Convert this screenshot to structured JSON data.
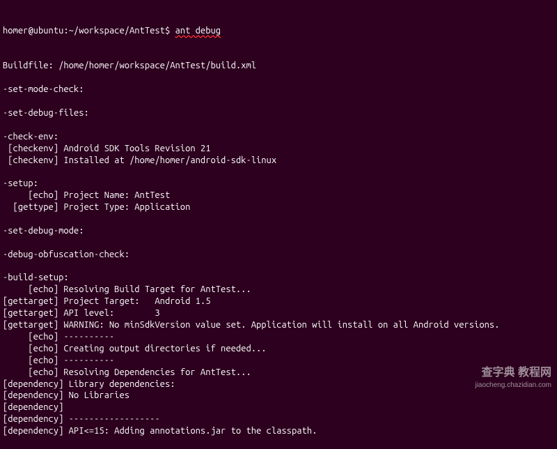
{
  "prompt": "homer@ubuntu:~/workspace/AntTest$ ",
  "command": "ant debug",
  "output": [
    "Buildfile: /home/homer/workspace/AntTest/build.xml",
    "",
    "-set-mode-check:",
    "",
    "-set-debug-files:",
    "",
    "-check-env:",
    " [checkenv] Android SDK Tools Revision 21",
    " [checkenv] Installed at /home/homer/android-sdk-linux",
    "",
    "-setup:",
    "     [echo] Project Name: AntTest",
    "  [gettype] Project Type: Application",
    "",
    "-set-debug-mode:",
    "",
    "-debug-obfuscation-check:",
    "",
    "-build-setup:",
    "     [echo] Resolving Build Target for AntTest...",
    "[gettarget] Project Target:   Android 1.5",
    "[gettarget] API level:        3",
    "[gettarget] WARNING: No minSdkVersion value set. Application will install on all Android versions.",
    "     [echo] ----------",
    "     [echo] Creating output directories if needed...",
    "     [echo] ----------",
    "     [echo] Resolving Dependencies for AntTest...",
    "[dependency] Library dependencies:",
    "[dependency] No Libraries",
    "[dependency] ",
    "[dependency] ------------------",
    "[dependency] API<=15: Adding annotations.jar to the classpath."
  ],
  "watermark": {
    "main": "查字典 教程网",
    "sub": "jiaocheng.chazidian.com"
  }
}
